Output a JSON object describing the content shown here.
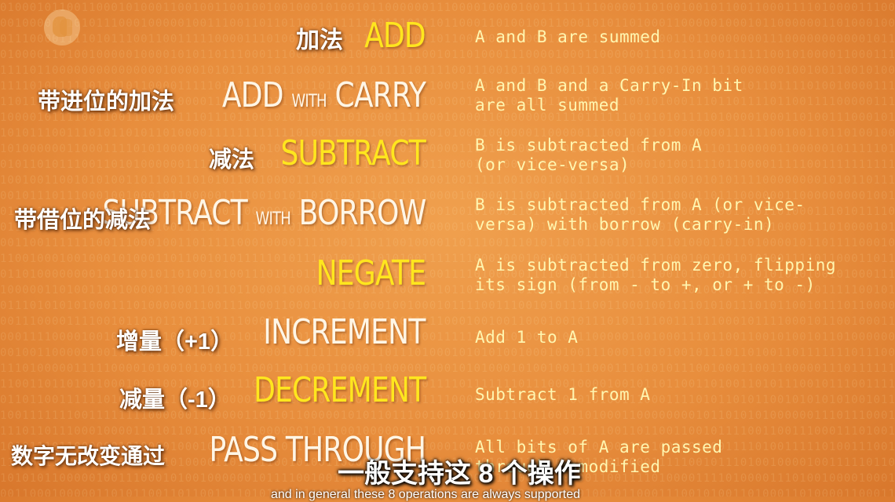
{
  "operations": [
    {
      "zh": "加法",
      "en": "ADD",
      "en_small": "",
      "en2": "",
      "color": "yellow",
      "desc": "A and B are summed"
    },
    {
      "zh": "带进位的加法",
      "en": "ADD ",
      "en_small": "WITH",
      "en2": " CARRY",
      "color": "white",
      "desc": "A and B and a Carry-In bit\nare all summed"
    },
    {
      "zh": "减法",
      "en": "SUBTRACT",
      "en_small": "",
      "en2": "",
      "color": "yellow",
      "desc": "B is subtracted from A\n(or vice-versa)"
    },
    {
      "zh": "带借位的减法",
      "en": "SUBTRACT ",
      "en_small": "WITH",
      "en2": " BORROW",
      "color": "white",
      "desc": "B is subtracted from A (or vice-\nversa) with borrow (carry-in)"
    },
    {
      "zh": "",
      "en": "NEGATE",
      "en_small": "",
      "en2": "",
      "color": "yellow",
      "desc": "A is subtracted from zero, flipping\nits sign (from - to +, or + to -)"
    },
    {
      "zh": "增量（+1）",
      "en": "INCREMENT",
      "en_small": "",
      "en2": "",
      "color": "white",
      "desc": "Add 1 to A"
    },
    {
      "zh": "减量（-1）",
      "en": "DECREMENT",
      "en_small": "",
      "en2": "",
      "color": "yellow",
      "desc": "Subtract 1 from A"
    },
    {
      "zh": "数字无改变通过",
      "en": "PASS THROUGH",
      "en_small": "",
      "en2": "",
      "color": "white",
      "desc": "All bits of A are passed\nthrough unmodified"
    }
  ],
  "subtitle": "一般支持这 8 个操作",
  "caption": "and in general these 8 operations are always supported"
}
